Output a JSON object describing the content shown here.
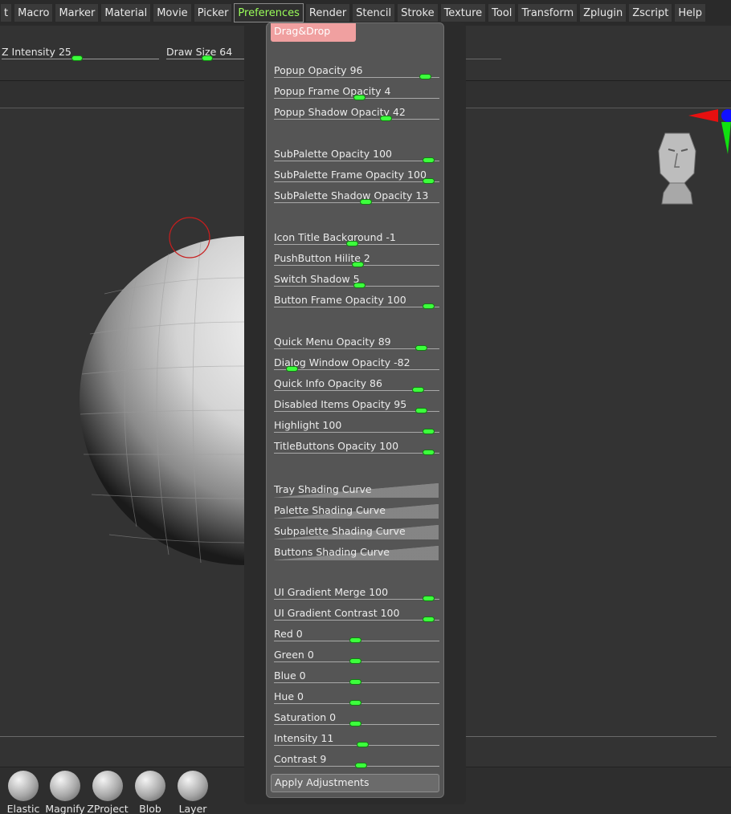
{
  "menubar": {
    "items": [
      "t",
      "Macro",
      "Marker",
      "Material",
      "Movie",
      "Picker",
      "Preferences",
      "Render",
      "Stencil",
      "Stroke",
      "Texture",
      "Tool",
      "Transform",
      "Zplugin",
      "Zscript",
      "Help"
    ],
    "active_index": 6
  },
  "toolbar": {
    "z_intensity": {
      "label": "Z Intensity",
      "value": "25"
    },
    "draw_size": {
      "label": "Draw Size",
      "value": "64"
    }
  },
  "preferences": {
    "drag_drop_label": "Drag&Drop",
    "sliders": [
      {
        "label": "Popup Opacity",
        "value": "96",
        "pos": 0.95
      },
      {
        "label": "Popup Frame Opacity",
        "value": "4",
        "pos": 0.52
      },
      {
        "label": "Popup Shadow Opacity",
        "value": "42",
        "pos": 0.69
      },
      {
        "label": "SubPalette Opacity",
        "value": "100",
        "pos": 0.97
      },
      {
        "label": "SubPalette Frame Opacity",
        "value": "100",
        "pos": 0.97
      },
      {
        "label": "SubPalette Shadow Opacity",
        "value": "13",
        "pos": 0.56
      },
      {
        "label": "Icon Title Background",
        "value": "-1",
        "pos": 0.47
      },
      {
        "label": "PushButton Hilite",
        "value": "2",
        "pos": 0.51
      },
      {
        "label": "Switch Shadow",
        "value": "5",
        "pos": 0.52
      },
      {
        "label": "Button Frame Opacity",
        "value": "100",
        "pos": 0.97
      },
      {
        "label": "Quick Menu Opacity",
        "value": "89",
        "pos": 0.92
      },
      {
        "label": "Dialog Window Opacity",
        "value": "-82",
        "pos": 0.08
      },
      {
        "label": "Quick Info Opacity",
        "value": "86",
        "pos": 0.9
      },
      {
        "label": "Disabled Items Opacity",
        "value": "95",
        "pos": 0.92
      },
      {
        "label": "Highlight",
        "value": "100",
        "pos": 0.97
      },
      {
        "label": "TitleButtons Opacity",
        "value": "100",
        "pos": 0.97
      },
      {
        "label": "UI Gradient Merge",
        "value": "100",
        "pos": 0.97
      },
      {
        "label": "UI Gradient Contrast",
        "value": "100",
        "pos": 0.97
      },
      {
        "label": "Red",
        "value": "0",
        "pos": 0.49
      },
      {
        "label": "Green",
        "value": "0",
        "pos": 0.49
      },
      {
        "label": "Blue",
        "value": "0",
        "pos": 0.49
      },
      {
        "label": "Hue",
        "value": "0",
        "pos": 0.49
      },
      {
        "label": "Saturation",
        "value": "0",
        "pos": 0.49
      },
      {
        "label": "Intensity",
        "value": "11",
        "pos": 0.54
      },
      {
        "label": "Contrast",
        "value": "9",
        "pos": 0.53
      }
    ],
    "curves": [
      "Tray Shading Curve",
      "Palette Shading Curve",
      "Subpalette Shading Curve",
      "Buttons Shading Curve"
    ],
    "apply_label": "Apply Adjustments"
  },
  "brushes": [
    "Elastic",
    "Magnify",
    "ZProject",
    "Blob",
    "Layer"
  ],
  "colors": {
    "accent_green": "#3cff3c",
    "active_menu_text": "#9bff5a",
    "dragdrop_bg": "#f0a0a0",
    "brush_cursor": "#c81e1e"
  }
}
